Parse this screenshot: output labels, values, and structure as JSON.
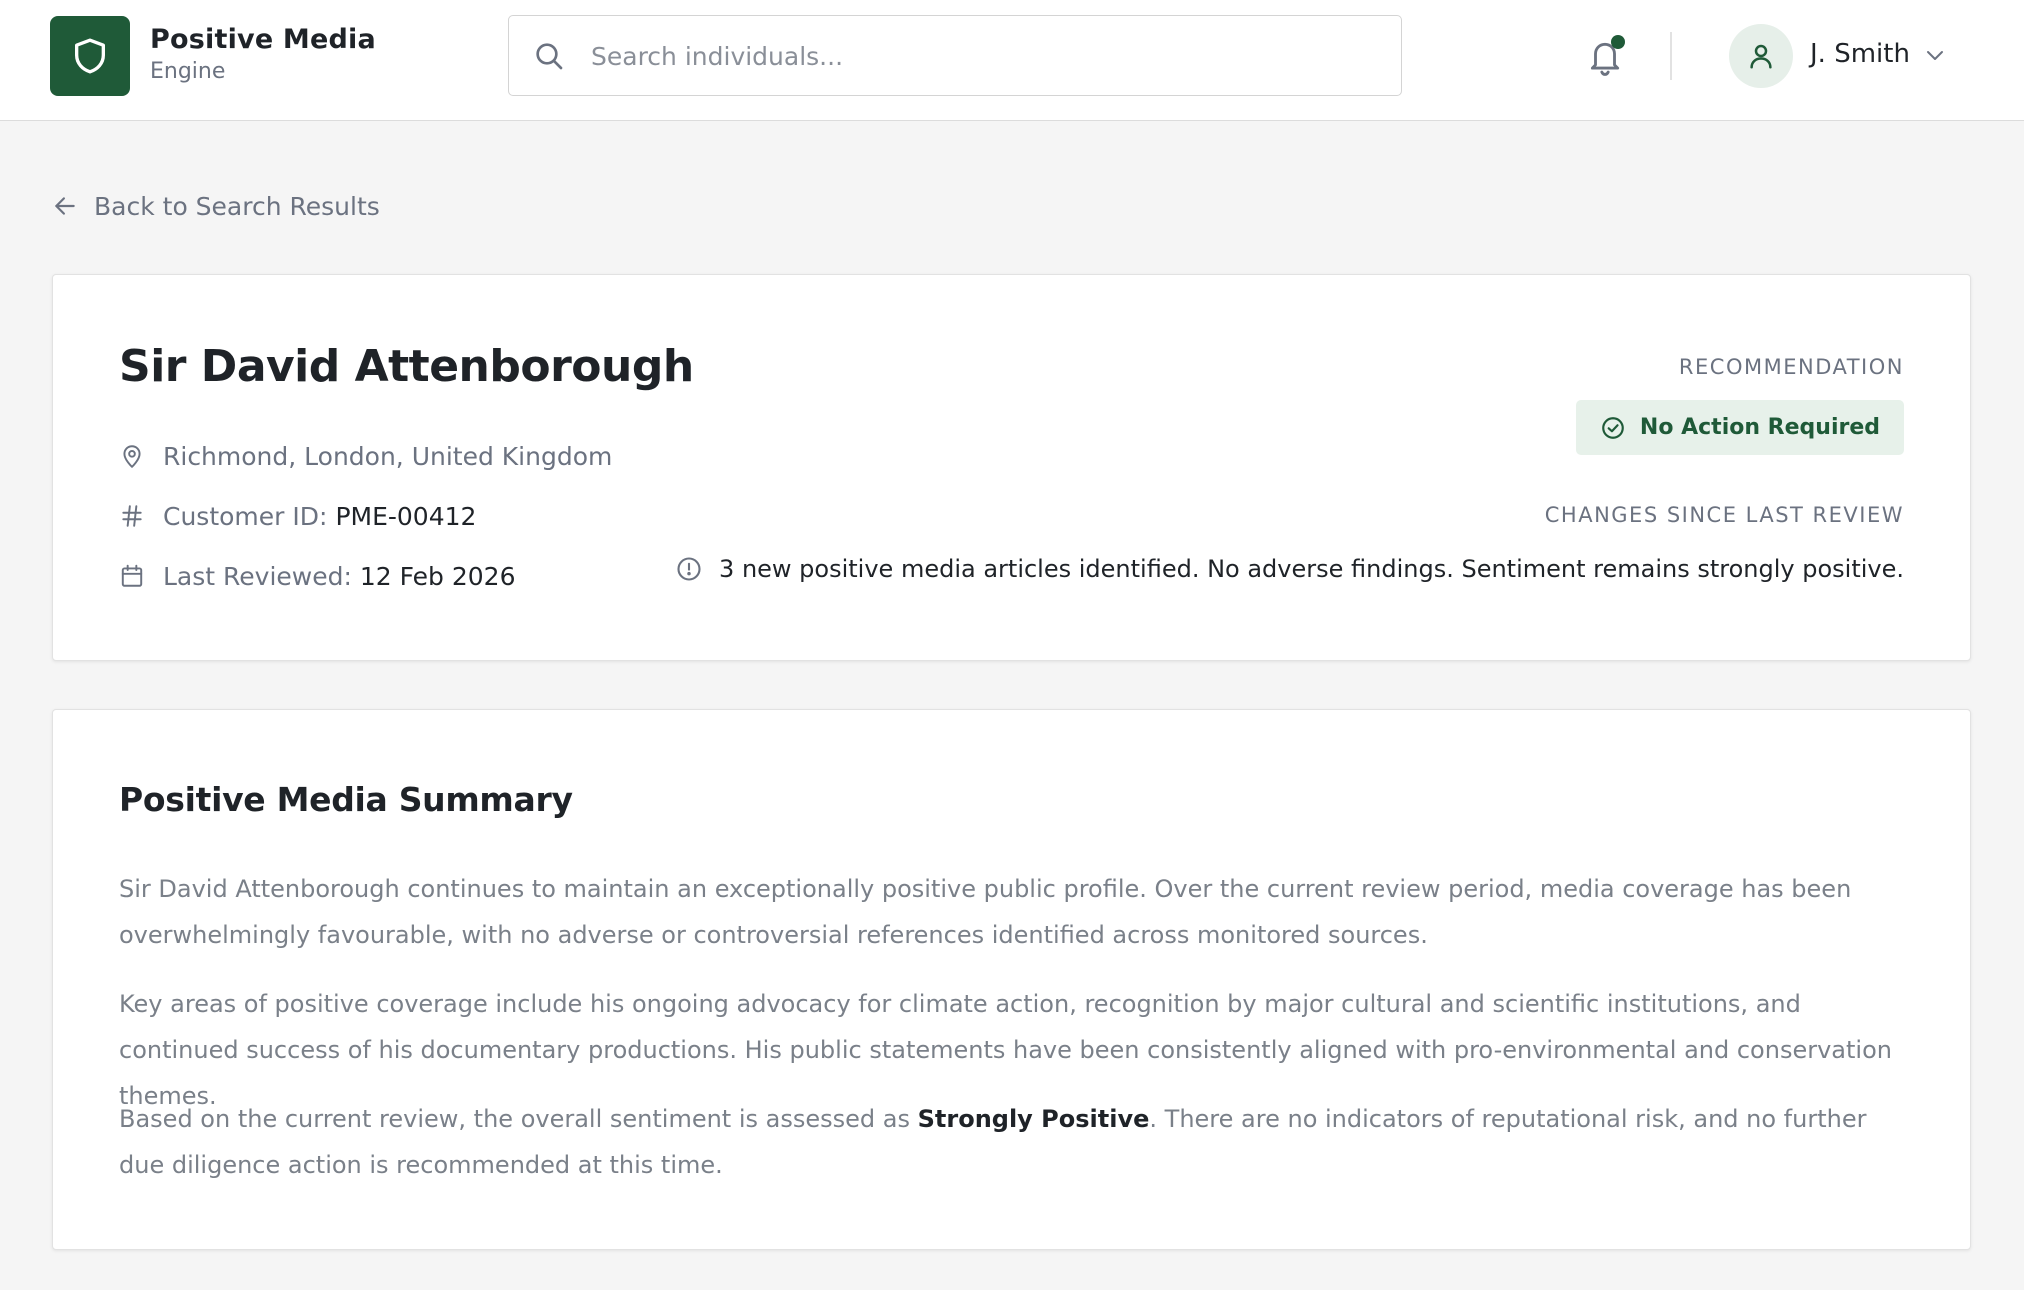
{
  "app": {
    "brand_title": "Positive Media",
    "brand_subtitle": "Engine",
    "logo_icon": "shield-icon",
    "accent_color": "#1f5a38"
  },
  "header": {
    "search_placeholder": "Search individuals...",
    "search_value": "",
    "notification_icon": "bell-icon",
    "has_unread_notifications": true,
    "user_name": "J. Smith"
  },
  "navigation": {
    "back_label": "Back to Search Results"
  },
  "profile": {
    "name": "Sir David Attenborough",
    "location": "Richmond, London, United Kingdom",
    "customer_id_label": "Customer ID:",
    "customer_id": "PME-00412",
    "last_reviewed_label": "Last Reviewed:",
    "last_reviewed": "12 Feb 2026",
    "recommendation_label": "RECOMMENDATION",
    "recommendation_value": "No Action Required",
    "recommendation_color": "#1f5a38",
    "changes_label": "CHANGES SINCE LAST REVIEW",
    "changes_text": "3 new positive media articles identified. No adverse findings. Sentiment remains strongly positive."
  },
  "summary": {
    "title": "Positive Media Summary",
    "paragraph_1": "Sir David Attenborough continues to maintain an exceptionally positive public profile. Over the current review period, media coverage has been overwhelmingly favourable, with no adverse or controversial references identified across monitored sources.",
    "paragraph_2": "Key areas of positive coverage include his ongoing advocacy for climate action, recognition by major cultural and scientific institutions, and continued success of his documentary productions. His public statements have been consistently aligned with pro-environmental and conservation themes.",
    "paragraph_3_before": "Based on the current review, the overall sentiment is assessed as ",
    "paragraph_3_emphasis": "Strongly Positive",
    "paragraph_3_after": ". There are no indicators of reputational risk, and no further due diligence action is recommended at this time."
  }
}
